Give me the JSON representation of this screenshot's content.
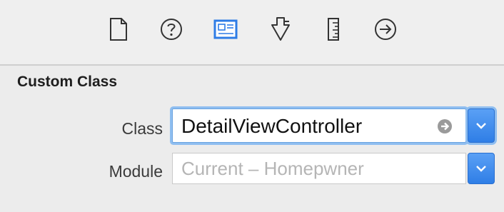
{
  "toolbar": {
    "items": [
      {
        "icon": "file-inspector-icon"
      },
      {
        "icon": "quick-help-icon"
      },
      {
        "icon": "identity-inspector-icon",
        "selected": true,
        "accent": "#2e7ce6"
      },
      {
        "icon": "attributes-inspector-icon"
      },
      {
        "icon": "size-inspector-icon"
      },
      {
        "icon": "connections-inspector-icon"
      }
    ]
  },
  "custom_class": {
    "section_title": "Custom Class",
    "class_label": "Class",
    "class_value": "DetailViewController",
    "module_label": "Module",
    "module_placeholder": "Current – Homepwner"
  },
  "colors": {
    "accent": "#2e7ce6",
    "focus_ring": "#8fbef0"
  }
}
